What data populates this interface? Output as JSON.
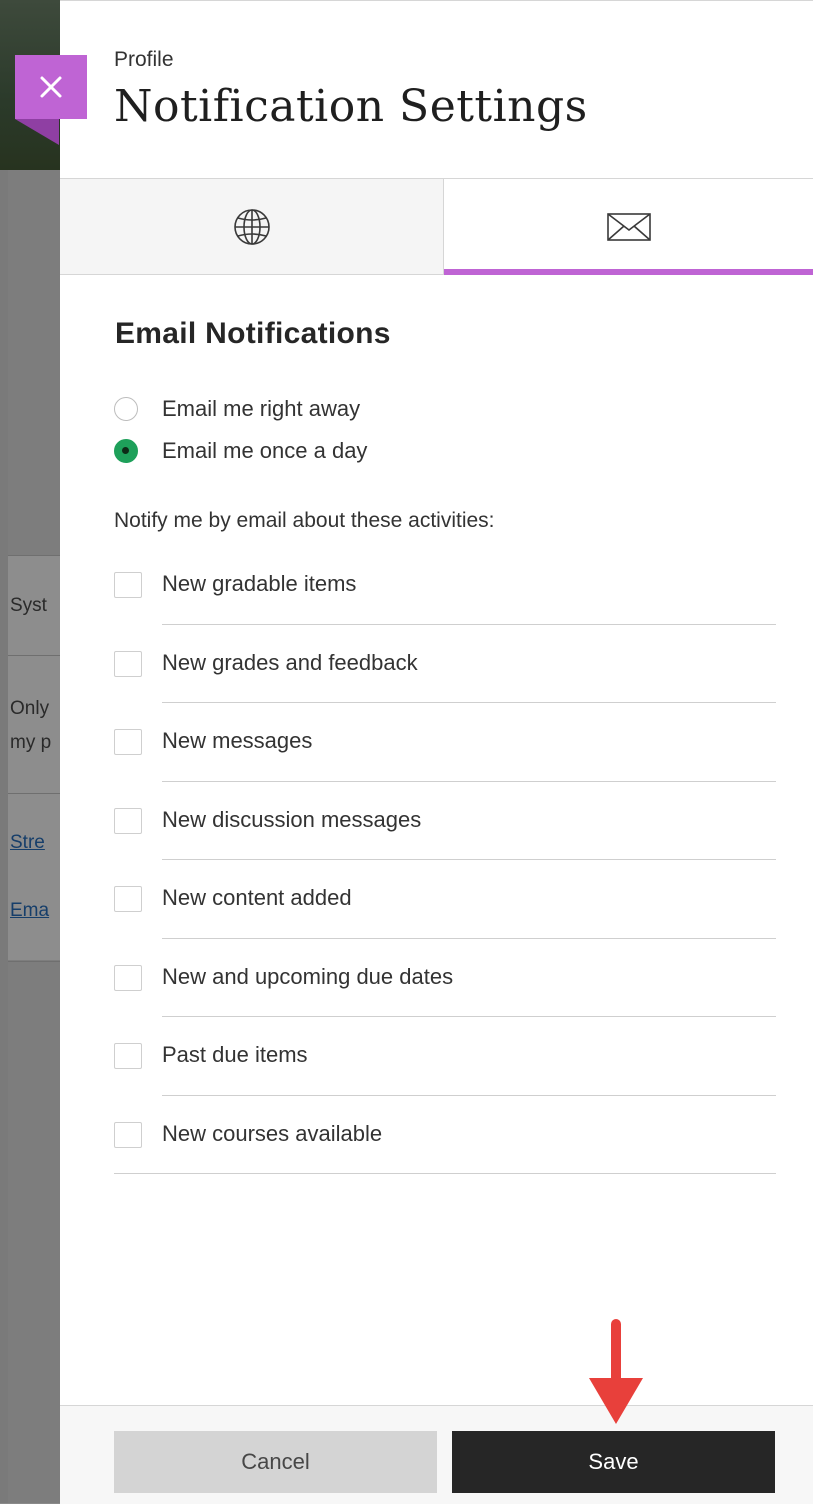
{
  "background": {
    "rows": [
      "Syst",
      "Only",
      "my p"
    ],
    "links": [
      "Stre",
      "Ema"
    ]
  },
  "panel": {
    "breadcrumb": "Profile",
    "title": "Notification Settings",
    "tabs": [
      {
        "name": "global",
        "icon": "globe-icon",
        "active": false
      },
      {
        "name": "email",
        "icon": "envelope-icon",
        "active": true
      }
    ],
    "section_title": "Email Notifications",
    "frequency": {
      "options": [
        {
          "label": "Email me right away",
          "selected": false
        },
        {
          "label": "Email me once a day",
          "selected": true
        }
      ]
    },
    "notify_prompt": "Notify me by email about these activities:",
    "activities": [
      {
        "label": "New gradable items",
        "checked": false
      },
      {
        "label": "New grades and feedback",
        "checked": false
      },
      {
        "label": "New messages",
        "checked": false
      },
      {
        "label": "New discussion messages",
        "checked": false
      },
      {
        "label": "New content added",
        "checked": false
      },
      {
        "label": "New and upcoming due dates",
        "checked": false
      },
      {
        "label": "Past due items",
        "checked": false
      },
      {
        "label": "New courses available",
        "checked": false
      }
    ],
    "footer": {
      "cancel_label": "Cancel",
      "save_label": "Save"
    }
  },
  "colors": {
    "accent": "#bf64d4",
    "radio_selected": "#1ea05a",
    "save_bg": "#262626",
    "cancel_bg": "#d4d4d4",
    "annotation_arrow": "#e8403b"
  }
}
